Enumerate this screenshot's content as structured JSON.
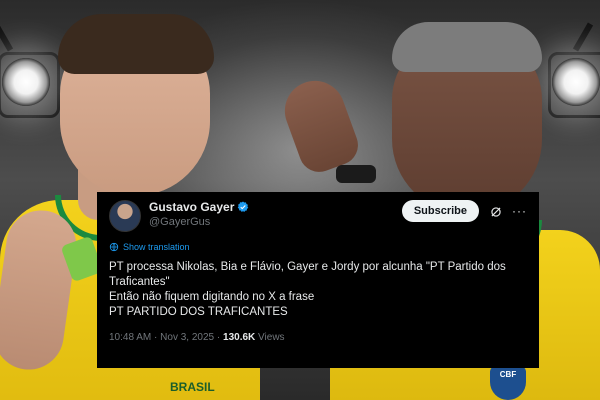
{
  "tweet": {
    "author_name": "Gustavo Gayer",
    "author_handle": "@GayerGus",
    "subscribe_label": "Subscribe",
    "more_label": "···",
    "translate_label": "Show translation",
    "lines": [
      "PT processa Nikolas, Bia e Flávio, Gayer e Jordy por alcunha \"PT Partido dos Traficantes\"",
      "Então não fiquem digitando no X a frase",
      "PT PARTIDO DOS TRAFICANTES"
    ],
    "time": "10:48 AM",
    "separator": "·",
    "date": "Nov 3, 2025",
    "views_count": "130.6K",
    "views_label": "Views"
  },
  "background": {
    "shirt_left_text": "BRASIL",
    "crest_text": "CBF"
  },
  "colors": {
    "card_bg": "#000000",
    "link": "#1d9bf0",
    "verified": "#1d9bf0",
    "muted": "#71767b",
    "shirt_yellow": "#f3d21c",
    "shirt_green": "#1b8a3f"
  },
  "icons": {
    "verified": "verified-badge-icon",
    "grok": "grok-icon",
    "more": "more-icon",
    "translate": "translate-globe-icon"
  }
}
